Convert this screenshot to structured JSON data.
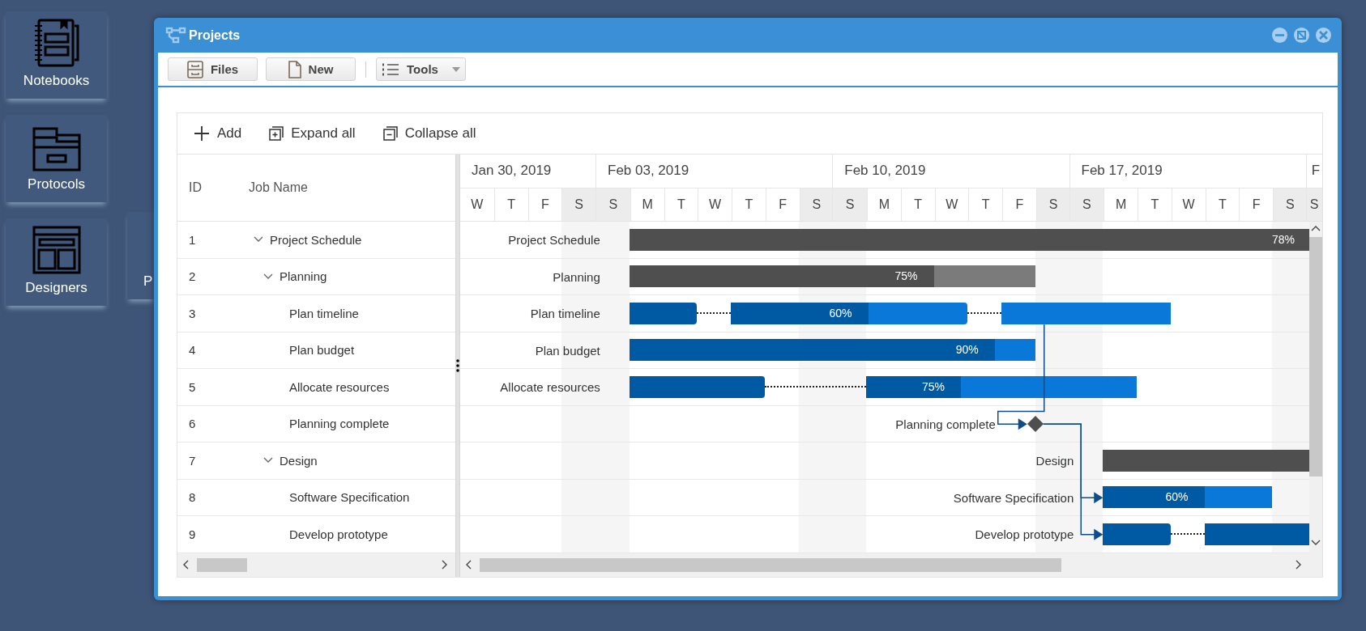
{
  "desktop": {
    "tiles": [
      {
        "label": "Notebooks",
        "kind": "notebook"
      },
      {
        "label": "Protocols",
        "kind": "cabinet"
      },
      {
        "label": "Designers",
        "kind": "layout"
      },
      {
        "label": "P",
        "kind": "covered"
      }
    ]
  },
  "window": {
    "title": "Projects",
    "toolbar": [
      {
        "label": "Files",
        "kind": "files",
        "dropdown": false
      },
      {
        "label": "New",
        "kind": "new",
        "dropdown": false
      },
      {
        "label": "Tools",
        "kind": "tools",
        "dropdown": true
      }
    ]
  },
  "gantt": {
    "toolbar": [
      {
        "label": "Add",
        "kind": "add"
      },
      {
        "label": "Expand all",
        "kind": "expand"
      },
      {
        "label": "Collapse all",
        "kind": "collapse"
      }
    ],
    "columns": [
      "ID",
      "Job Name"
    ],
    "timeline": {
      "weeks": [
        {
          "label": "Jan 30, 2019",
          "days": [
            {
              "letter": "W",
              "weekend": false
            },
            {
              "letter": "T",
              "weekend": false
            },
            {
              "letter": "F",
              "weekend": false
            },
            {
              "letter": "S",
              "weekend": true
            }
          ]
        },
        {
          "label": "Feb 03, 2019",
          "days": [
            {
              "letter": "S",
              "weekend": true
            },
            {
              "letter": "M",
              "weekend": false
            },
            {
              "letter": "T",
              "weekend": false
            },
            {
              "letter": "W",
              "weekend": false
            },
            {
              "letter": "T",
              "weekend": false
            },
            {
              "letter": "F",
              "weekend": false
            },
            {
              "letter": "S",
              "weekend": true
            }
          ]
        },
        {
          "label": "Feb 10, 2019",
          "days": [
            {
              "letter": "S",
              "weekend": true
            },
            {
              "letter": "M",
              "weekend": false
            },
            {
              "letter": "T",
              "weekend": false
            },
            {
              "letter": "W",
              "weekend": false
            },
            {
              "letter": "T",
              "weekend": false
            },
            {
              "letter": "F",
              "weekend": false
            },
            {
              "letter": "S",
              "weekend": true
            }
          ]
        },
        {
          "label": "Feb 17, 2019",
          "days": [
            {
              "letter": "S",
              "weekend": true
            },
            {
              "letter": "M",
              "weekend": false
            },
            {
              "letter": "T",
              "weekend": false
            },
            {
              "letter": "W",
              "weekend": false
            },
            {
              "letter": "T",
              "weekend": false
            },
            {
              "letter": "F",
              "weekend": false
            },
            {
              "letter": "S",
              "weekend": true
            }
          ]
        },
        {
          "label": "F",
          "days": [
            {
              "letter": "S",
              "weekend": true
            }
          ]
        }
      ]
    },
    "tasks": [
      {
        "id": "1",
        "name": "Project Schedule",
        "chart_label": "Project Schedule",
        "kind": "summary",
        "expanded": true,
        "segments": [
          {
            "complete": true,
            "percent": "78%"
          }
        ],
        "children": [
          {
            "id": "2",
            "name": "Planning",
            "chart_label": "Planning",
            "kind": "summary",
            "expanded": true,
            "segments": [
              {
                "level": 0.75,
                "percent": "75%"
              }
            ],
            "children": [
              {
                "id": "3",
                "name": "Plan timeline",
                "chart_label": "Plan timeline",
                "kind": "task",
                "segments": [
                  {
                    "complete": true
                  },
                  {
                    "level": 0.58,
                    "percent": "60%"
                  },
                  {
                    "complete": false
                  }
                ]
              },
              {
                "id": "4",
                "name": "Plan budget",
                "chart_label": "Plan budget",
                "kind": "task",
                "segments": [
                  {
                    "level": 0.9,
                    "percent": "90%"
                  }
                ]
              },
              {
                "id": "5",
                "name": "Allocate resources",
                "chart_label": "Allocate resources",
                "kind": "task",
                "segments": [
                  {
                    "complete": true
                  },
                  {
                    "level": 0.35,
                    "percent": "75%"
                  }
                ]
              },
              {
                "id": "6",
                "name": "Planning complete",
                "chart_label": "Planning complete",
                "kind": "milestone"
              }
            ]
          },
          {
            "id": "7",
            "name": "Design",
            "chart_label": "Design",
            "kind": "summary",
            "expanded": true,
            "segments": [
              {
                "complete": true
              }
            ],
            "children": [
              {
                "id": "8",
                "name": "Software Specification",
                "chart_label": "Software Specification",
                "kind": "task",
                "segments": [
                  {
                    "level": 0.6,
                    "percent": "60%"
                  }
                ]
              },
              {
                "id": "9",
                "name": "Develop prototype",
                "chart_label": "Develop prototype",
                "kind": "task",
                "segments": [
                  {
                    "complete": true
                  },
                  {
                    "complete": true
                  }
                ]
              }
            ]
          }
        ]
      }
    ]
  }
}
